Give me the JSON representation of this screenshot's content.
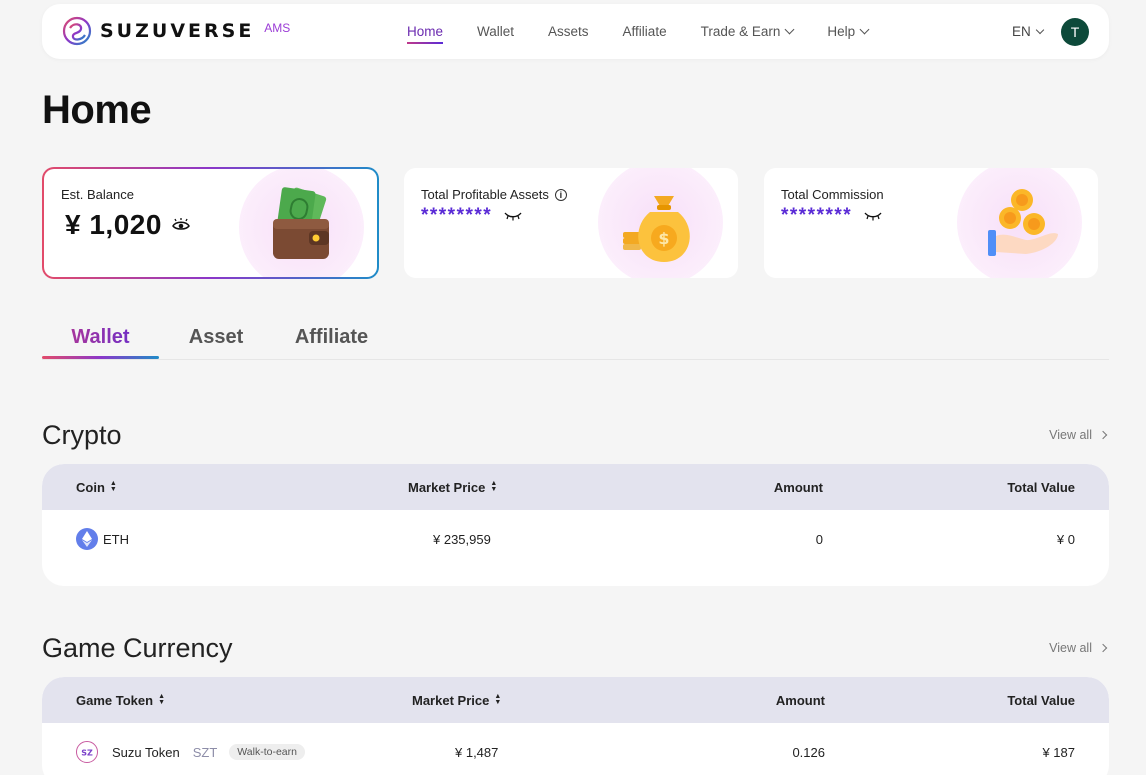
{
  "nav": {
    "brand": "SUZUVERSE",
    "brand_suffix": "AMS",
    "items": [
      {
        "label": "Home",
        "active": true
      },
      {
        "label": "Wallet"
      },
      {
        "label": "Assets"
      },
      {
        "label": "Affiliate"
      },
      {
        "label": "Trade & Earn",
        "dropdown": true
      },
      {
        "label": "Help",
        "dropdown": true
      }
    ],
    "language": "EN",
    "avatar_initial": "T"
  },
  "page_title": "Home",
  "cards": {
    "balance": {
      "label": "Est. Balance",
      "value": "¥ 1,020",
      "icon": "wallet-with-cash-illustration"
    },
    "profitable": {
      "label": "Total Profitable Assets",
      "value": "********",
      "icon": "money-bag-illustration"
    },
    "commission": {
      "label": "Total Commission",
      "value": "********",
      "icon": "hand-with-coins-illustration"
    }
  },
  "tabs": [
    "Wallet",
    "Asset",
    "Affiliate"
  ],
  "crypto": {
    "title": "Crypto",
    "view_all": "View all",
    "columns": [
      "Coin",
      "Market Price",
      "Amount",
      "Total Value"
    ],
    "rows": [
      {
        "coin": "ETH",
        "price": "¥ 235,959",
        "amount": "0",
        "total": "¥ 0"
      }
    ]
  },
  "game": {
    "title": "Game Currency",
    "view_all": "View all",
    "columns": [
      "Game Token",
      "Market Price",
      "Amount",
      "Total Value"
    ],
    "rows": [
      {
        "name": "Suzu Token",
        "symbol": "SZT",
        "tag": "Walk-to-earn",
        "price": "¥ 1,487",
        "amount": "0.126",
        "total": "¥ 187"
      }
    ]
  },
  "colors": {
    "accent_purple": "#5a2bd6",
    "accent_pink": "#c0398a",
    "accent_blue": "#1f8cc8",
    "avatar": "#0d4a3a"
  }
}
